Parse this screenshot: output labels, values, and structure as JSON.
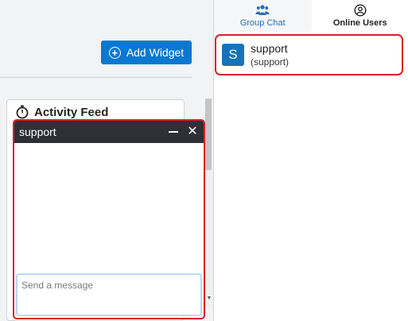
{
  "toolbar": {
    "add_widget_label": "Add Widget"
  },
  "activity_feed": {
    "title": "Activity Feed"
  },
  "chat_window": {
    "title": "support",
    "input_placeholder": "Send a message",
    "input_value": ""
  },
  "tabs": [
    {
      "label": "Group Chat",
      "icon": "group-icon",
      "active": false
    },
    {
      "label": "Online Users",
      "icon": "user-circle-icon",
      "active": true
    }
  ],
  "online_users": [
    {
      "avatar_letter": "S",
      "name": "support",
      "handle": "(support)"
    }
  ],
  "colors": {
    "accent": "#0b78d0",
    "avatar": "#1673bb",
    "highlight_border": "#d81f2a",
    "chat_header": "#2d3036"
  }
}
